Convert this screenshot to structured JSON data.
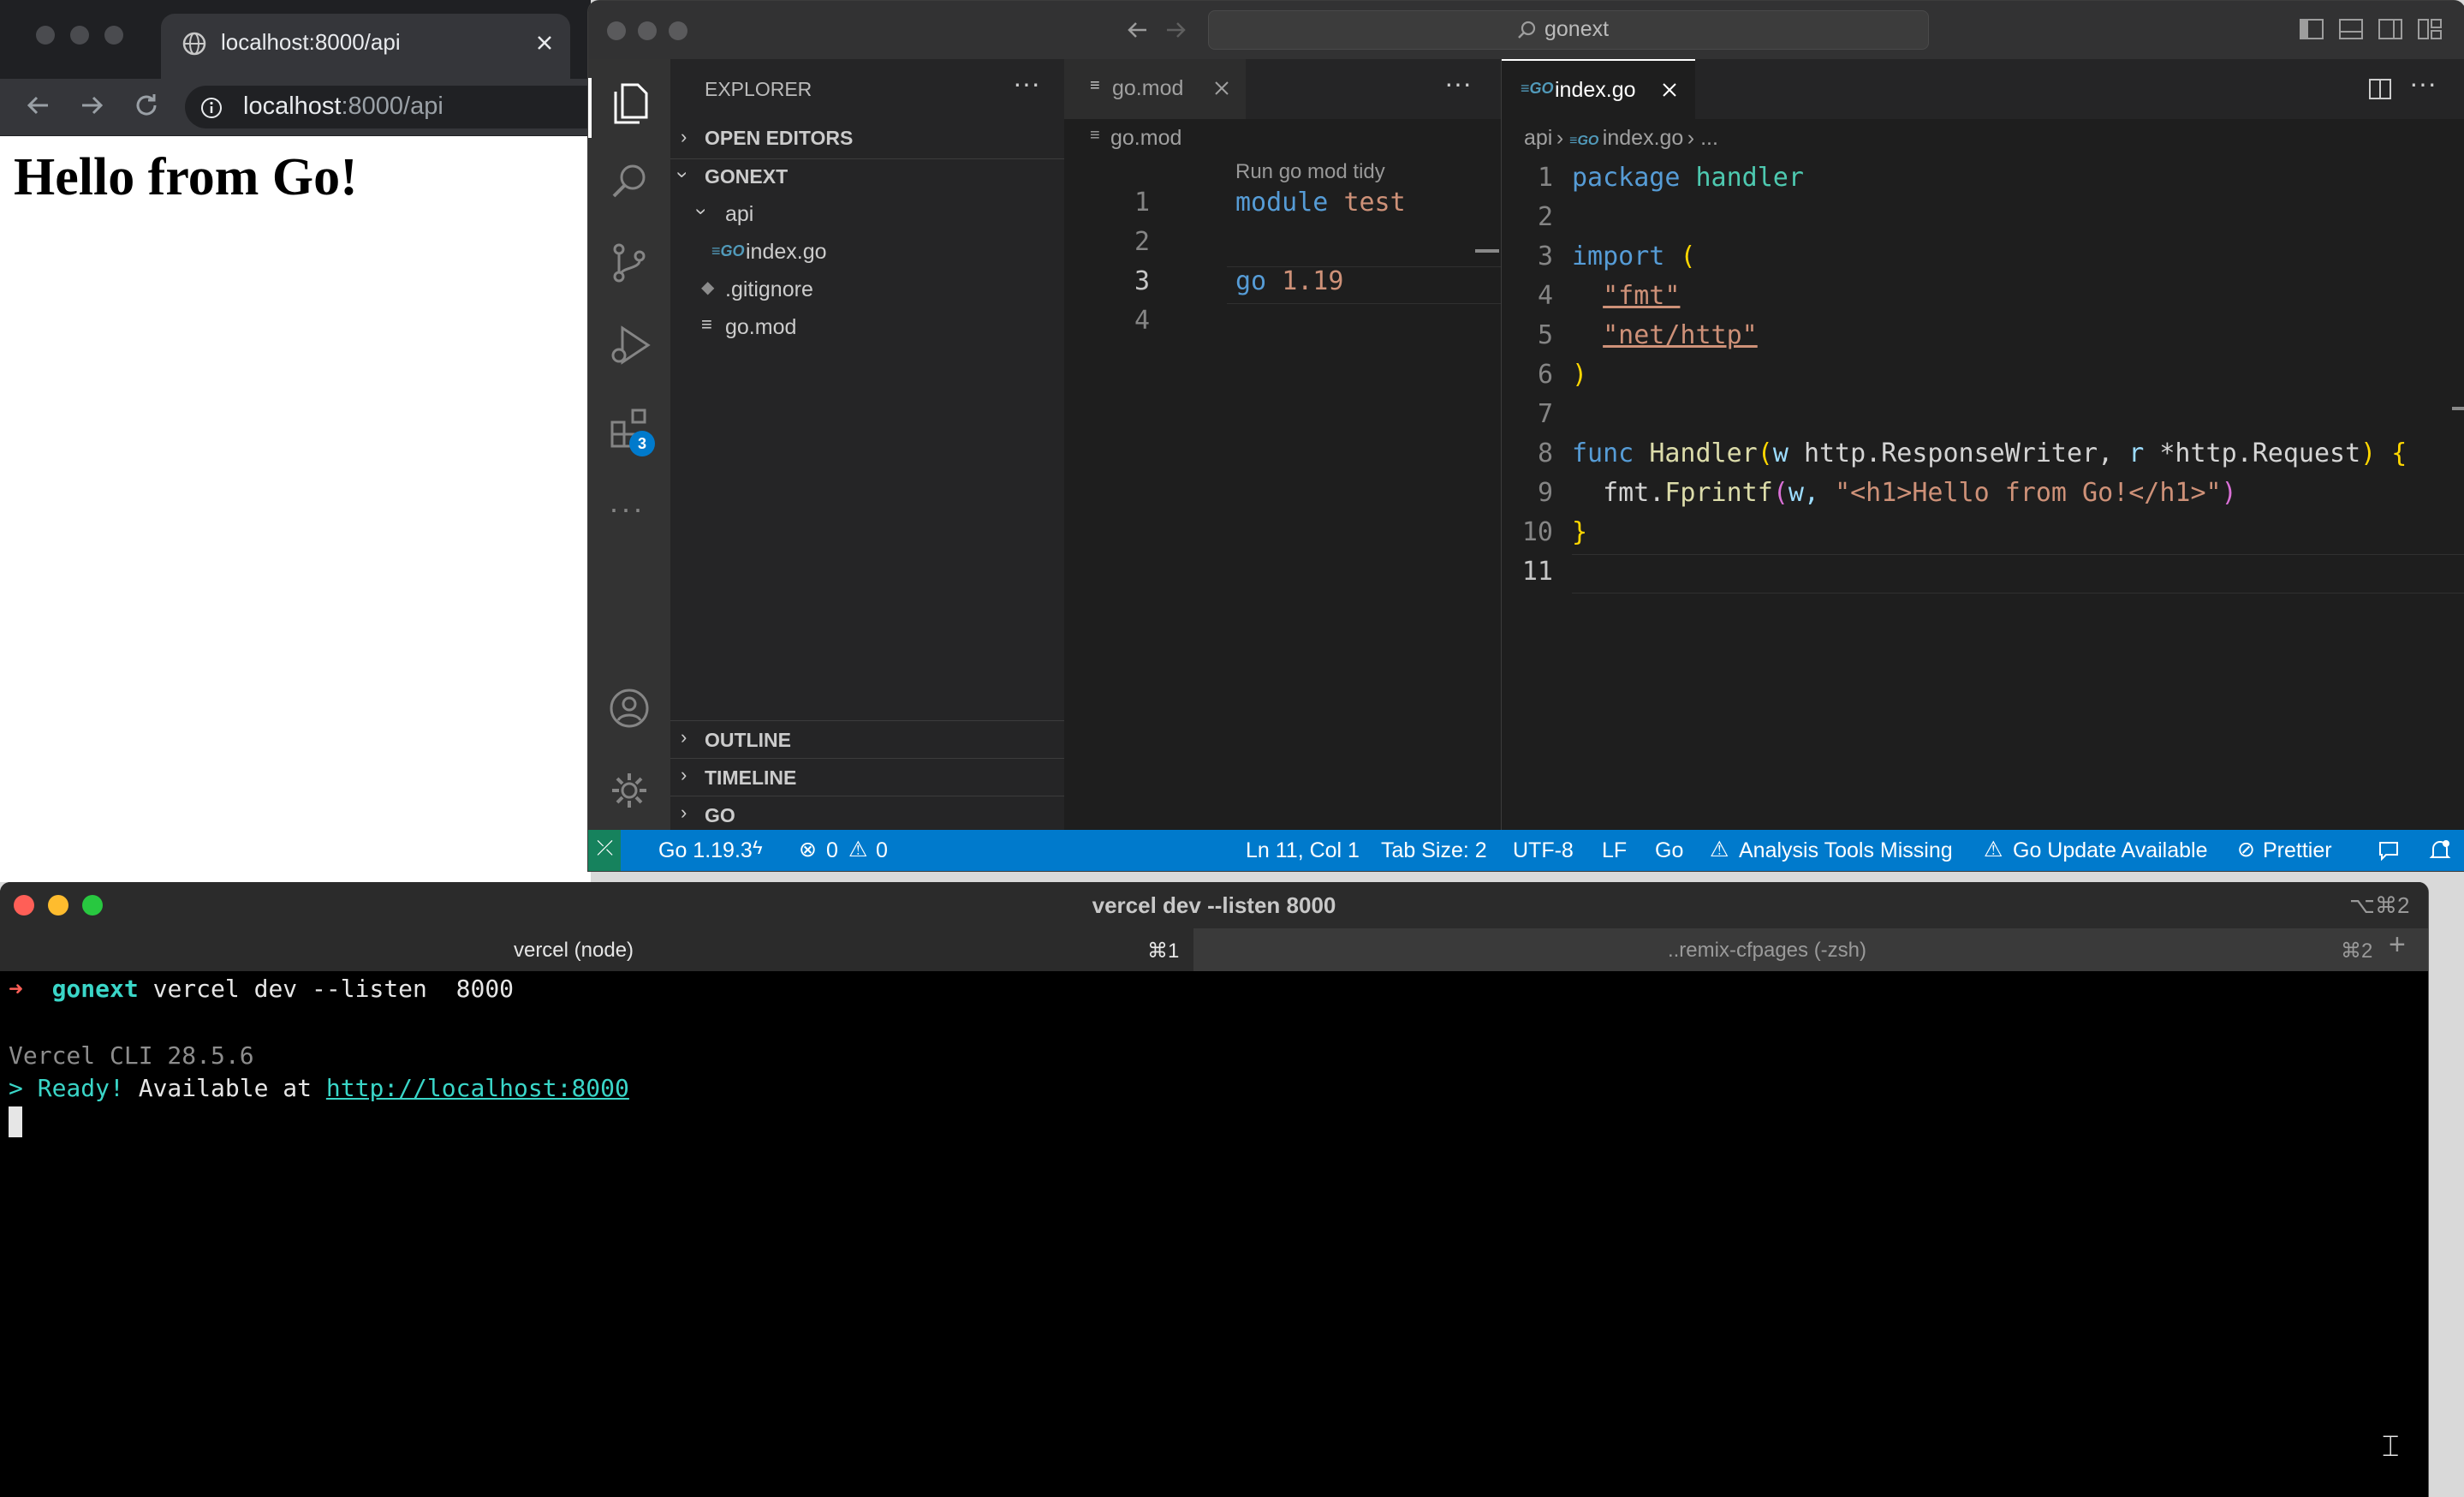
{
  "browser": {
    "tab_title": "localhost:8000/api",
    "url_host": "localhost",
    "url_rest": ":8000/api",
    "page_heading": "Hello from Go!"
  },
  "vscode": {
    "search": "gonext",
    "explorer": {
      "title": "EXPLORER",
      "open_editors": "OPEN EDITORS",
      "project": "GONEXT",
      "tree": [
        {
          "label": "api"
        },
        {
          "label": "index.go"
        },
        {
          "label": ".gitignore"
        },
        {
          "label": "go.mod"
        }
      ],
      "outline": "OUTLINE",
      "timeline": "TIMELINE",
      "go": "GO"
    },
    "extensions_badge": "3",
    "editor1": {
      "tab": "go.mod",
      "breadcrumb": "go.mod",
      "codelens": "Run go mod tidy",
      "line_numbers": [
        "1",
        "2",
        "3",
        "4"
      ],
      "line1_kw": "module",
      "line1_name": "test",
      "line3_kw": "go",
      "line3_ver": "1.19"
    },
    "editor2": {
      "tab": "index.go",
      "breadcrumb_folder": "api",
      "breadcrumb_file": "index.go",
      "breadcrumb_more": "...",
      "line_numbers": [
        "1",
        "2",
        "3",
        "4",
        "5",
        "6",
        "7",
        "8",
        "9",
        "10",
        "11"
      ],
      "code": {
        "package_kw": "package",
        "package_name": "handler",
        "import_kw": "import",
        "open_paren": "(",
        "fmt": "\"fmt\"",
        "nethttp": "\"net/http\"",
        "close_paren": ")",
        "func_kw": "func",
        "func_name": "Handler",
        "params_open": "(",
        "p1_name": "w",
        "p1_type": "http.ResponseWriter",
        "comma": ",",
        "p2_name": "r",
        "p2_type": "*http.Request",
        "params_close": ")",
        "open_brace": "{",
        "call_pkg": "fmt.",
        "call_fn": "Fprintf",
        "call_open": "(",
        "call_arg1": "w,",
        "call_str": "\"<h1>Hello from Go!</h1>\"",
        "call_close": ")",
        "close_brace": "}"
      }
    },
    "status": {
      "go_version": "Go 1.19.3",
      "errors": "0",
      "warnings": "0",
      "position": "Ln 11, Col 1",
      "tab_size": "Tab Size: 2",
      "encoding": "UTF-8",
      "eol": "LF",
      "language": "Go",
      "analysis": "Analysis Tools Missing",
      "update": "Go Update Available",
      "prettier": "Prettier"
    }
  },
  "terminal": {
    "title": "vercel dev --listen 8000",
    "title_shortcut": "⌥⌘2",
    "tab1_label": "vercel (node)",
    "tab1_shortcut": "⌘1",
    "tab2_label": "..remix-cfpages (-zsh)",
    "tab2_shortcut": "⌘2",
    "prompt_arrow": "➜",
    "prompt_dir": "gonext",
    "prompt_cmd": "vercel dev --listen  8000",
    "cli_version": "Vercel CLI 28.5.6",
    "ready_prefix": "> Ready!",
    "ready_text": "Available at",
    "ready_url": "http://localhost:8000"
  },
  "colors": {
    "vscode_status": "#007acc",
    "terminal_bg": "#000000",
    "browser_chrome": "#35363a"
  }
}
